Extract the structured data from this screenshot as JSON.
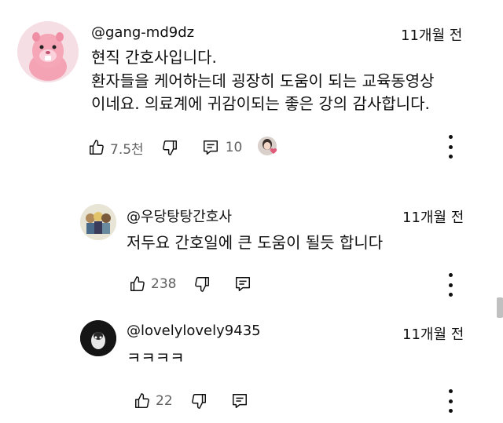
{
  "comments": [
    {
      "handle": "@gang-md9dz",
      "time": "11개월 전",
      "lines": [
        "현직 간호사입니다.",
        "환자들을 케어하는데 굉장히 도움이 되는 교육동영상",
        "이네요. 의료계에 귀감이되는 좋은 강의 감사합니다."
      ],
      "likes": "7.5천",
      "replies": "10"
    },
    {
      "handle": "@우당탕탕간호사",
      "time": "11개월 전",
      "lines": [
        "저두요 간호일에 큰 도움이 될듯 합니다"
      ],
      "likes": "238"
    },
    {
      "handle": "@lovelylovely9435",
      "time": "11개월 전",
      "lines": [
        "ㅋㅋㅋㅋ"
      ],
      "likes": "22"
    }
  ],
  "icons": {
    "like": "thumbs-up-icon",
    "dislike": "thumbs-down-icon",
    "reply": "comment-icon",
    "more": "more-vertical-icon",
    "creator_heart": "creator-heart-icon"
  },
  "colors": {
    "text": "#0f0f0f",
    "muted": "#606060",
    "heart": "#e05a7a"
  }
}
